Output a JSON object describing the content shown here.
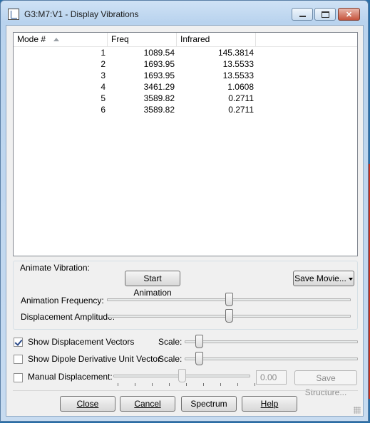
{
  "window": {
    "title": "G3:M7:V1 - Display Vibrations",
    "icon": "gaussview-icon"
  },
  "table": {
    "columns": [
      "Mode #",
      "Freq",
      "Infrared"
    ],
    "sort_column": "Mode #",
    "rows": [
      {
        "mode": "1",
        "freq": "1089.54",
        "ir": "145.3814"
      },
      {
        "mode": "2",
        "freq": "1693.95",
        "ir": "13.5533"
      },
      {
        "mode": "3",
        "freq": "1693.95",
        "ir": "13.5533"
      },
      {
        "mode": "4",
        "freq": "3461.29",
        "ir": "1.0608"
      },
      {
        "mode": "5",
        "freq": "3589.82",
        "ir": "0.2711"
      },
      {
        "mode": "6",
        "freq": "3589.82",
        "ir": "0.2711"
      }
    ]
  },
  "animate": {
    "group_label": "Animate Vibration:",
    "start_button": "Start Animation",
    "save_movie_button": "Save Movie...",
    "frequency_label": "Animation Frequency:",
    "amplitude_label": "Displacement Amplitude:",
    "frequency_level": 0.5,
    "amplitude_level": 0.5
  },
  "options": {
    "show_vectors": {
      "label": "Show Displacement Vectors",
      "checked": true,
      "scale_label": "Scale:",
      "scale_level": 0.0
    },
    "show_dipole": {
      "label": "Show Dipole Derivative Unit Vector",
      "checked": false,
      "scale_label": "Scale:",
      "scale_level": 0.0
    },
    "manual": {
      "label": "Manual Displacement:",
      "checked": false,
      "value": "0.00",
      "save_structure_button": "Save Structure...",
      "level": 0.5
    }
  },
  "buttons": {
    "close": "Close",
    "cancel": "Cancel",
    "spectrum": "Spectrum",
    "help": "Help"
  }
}
